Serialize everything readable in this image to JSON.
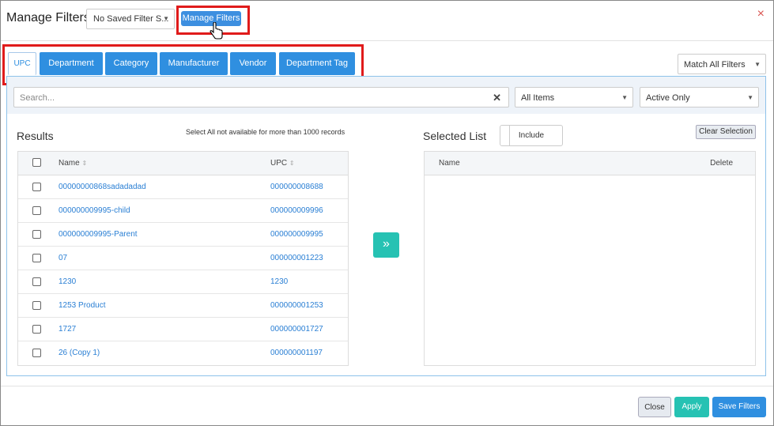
{
  "header": {
    "title": "Manage Filters",
    "saved_filter_value": "No Saved Filter S...",
    "manage_filters_label": "Manage Filters",
    "close_glyph": "×"
  },
  "tabs": [
    {
      "label": "UPC",
      "active": true
    },
    {
      "label": "Department"
    },
    {
      "label": "Category"
    },
    {
      "label": "Manufacturer"
    },
    {
      "label": "Vendor"
    },
    {
      "label": "Department Tag"
    }
  ],
  "match_select": {
    "value": "Match All Filters"
  },
  "search": {
    "placeholder": "Search..."
  },
  "items_select": {
    "value": "All Items"
  },
  "status_select": {
    "value": "Active Only"
  },
  "results": {
    "heading": "Results",
    "note": "Select All not available for more than 1000 records",
    "columns": {
      "name": "Name",
      "upc": "UPC"
    },
    "rows": [
      {
        "name": "00000000868sadadadad",
        "upc": "000000008688"
      },
      {
        "name": "000000009995-child",
        "upc": "000000009996"
      },
      {
        "name": "000000009995-Parent",
        "upc": "000000009995"
      },
      {
        "name": "07",
        "upc": "000000001223"
      },
      {
        "name": "1230",
        "upc": "1230"
      },
      {
        "name": "1253 Product",
        "upc": "000000001253"
      },
      {
        "name": "1727",
        "upc": "000000001727"
      },
      {
        "name": "26 (Copy 1)",
        "upc": "000000001197"
      }
    ]
  },
  "move_glyph": "»",
  "selected": {
    "heading": "Selected List",
    "include_label": "Include",
    "clear_label": "Clear Selection",
    "columns": {
      "name": "Name",
      "delete": "Delete"
    }
  },
  "footer": {
    "close_label": "Close",
    "apply_label": "Apply",
    "save_label": "Save Filters"
  },
  "colors": {
    "accent_blue": "#2f8fe0",
    "teal": "#26c2b3",
    "highlight_red": "#e01b1b"
  }
}
